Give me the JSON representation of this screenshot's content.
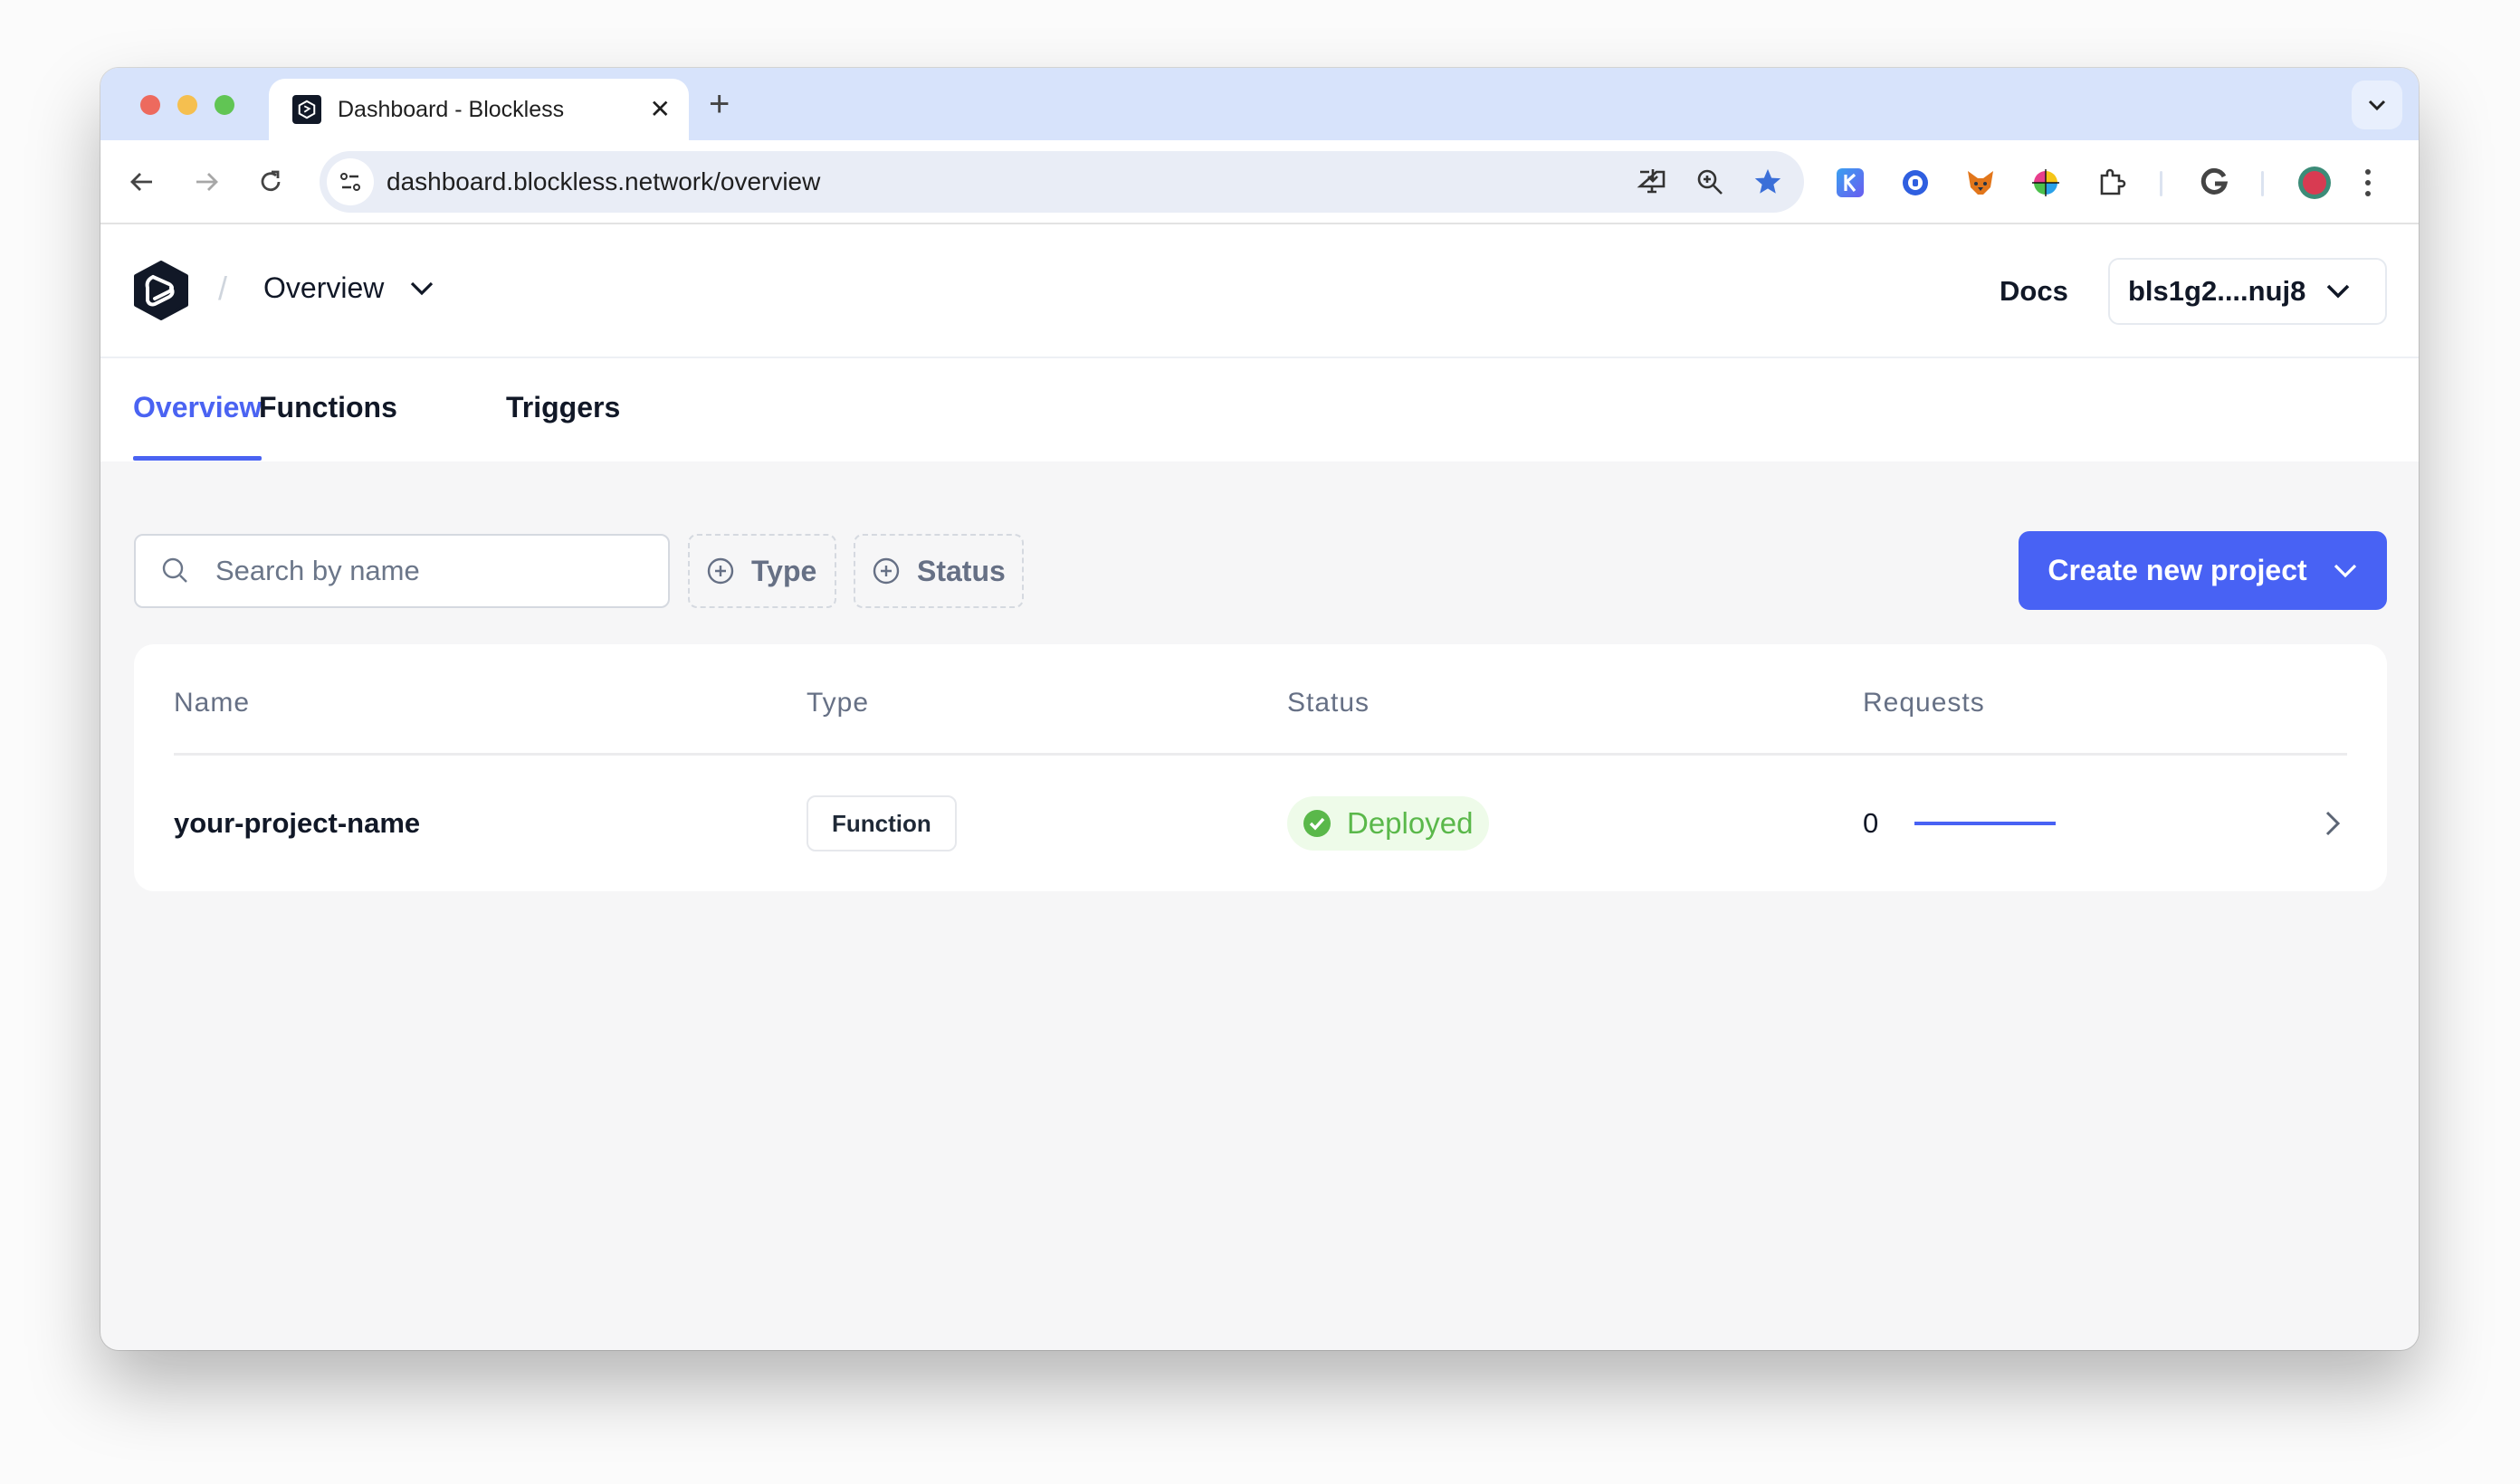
{
  "browser": {
    "tab_title": "Dashboard - Blockless",
    "tab_close_icon": "close-icon",
    "new_tab_icon": "plus-icon",
    "url": "dashboard.blockless.network/overview",
    "extensions": [
      "kiwi-extension",
      "blue-circle-extension",
      "metamask-extension",
      "color-wheel-extension",
      "puzzle-extensions-icon",
      "google-extension",
      "profile-avatar"
    ]
  },
  "header": {
    "breadcrumb_separator": "/",
    "breadcrumb_current": "Overview",
    "docs_label": "Docs",
    "wallet_address": "bls1g2....nuj8"
  },
  "nav": {
    "tabs": [
      {
        "label": "Overview",
        "active": true
      },
      {
        "label": "Functions",
        "active": false
      },
      {
        "label": "Triggers",
        "active": false
      }
    ]
  },
  "filters": {
    "search_placeholder": "Search by name",
    "search_value": "",
    "type_label": "Type",
    "status_label": "Status",
    "create_label": "Create new project"
  },
  "table": {
    "columns": [
      "Name",
      "Type",
      "Status",
      "Requests"
    ],
    "rows": [
      {
        "name": "your-project-name",
        "type": "Function",
        "status": "Deployed",
        "requests": "0"
      }
    ]
  },
  "colors": {
    "accent": "#4862f4",
    "status_success": "#5ab84a",
    "status_success_bg": "#eefbe9"
  }
}
